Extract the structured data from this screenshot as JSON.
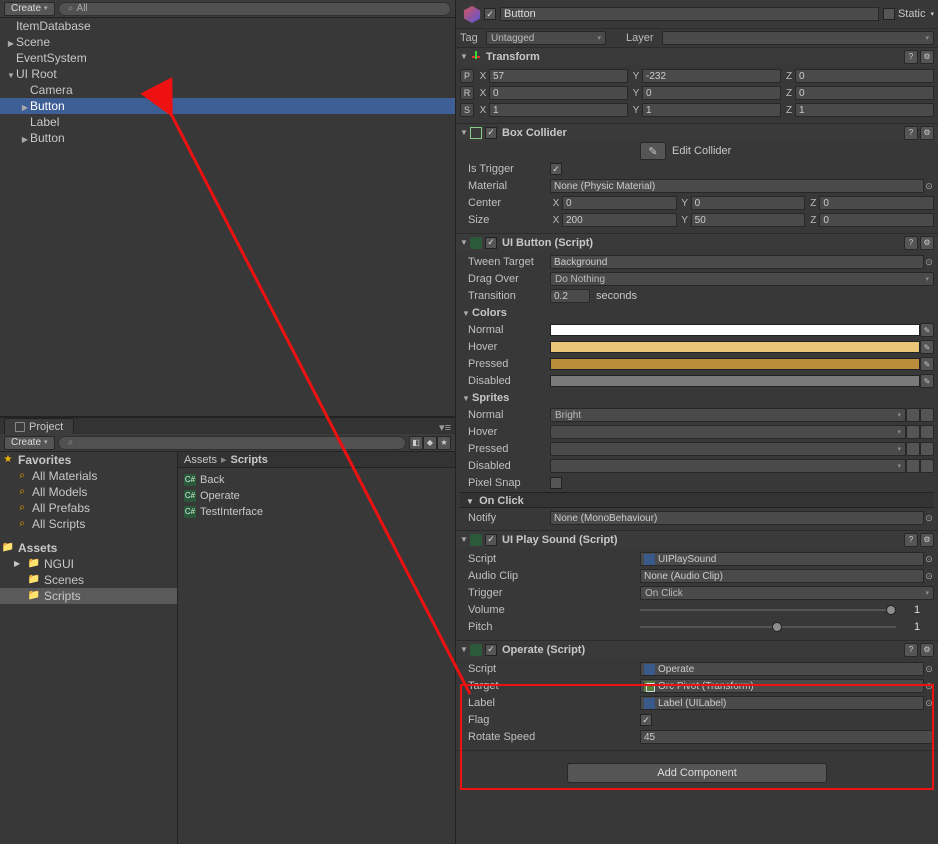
{
  "hierarchy": {
    "create_label": "Create",
    "search_prefix": "All",
    "items": [
      {
        "label": "ItemDatabase",
        "fold": "none",
        "pad": 0
      },
      {
        "label": "Scene",
        "fold": "closed",
        "pad": 0
      },
      {
        "label": "EventSystem",
        "fold": "none",
        "pad": 0
      },
      {
        "label": "UI Root",
        "fold": "open",
        "pad": 0
      },
      {
        "label": "Camera",
        "fold": "none",
        "pad": 1
      },
      {
        "label": "Button",
        "fold": "closed",
        "pad": 1,
        "selected": true
      },
      {
        "label": "Label",
        "fold": "none",
        "pad": 1
      },
      {
        "label": "Button",
        "fold": "closed",
        "pad": 1
      }
    ]
  },
  "project": {
    "tab_label": "Project",
    "create_label": "Create",
    "favorites_label": "Favorites",
    "favorites": [
      "All Materials",
      "All Models",
      "All Prefabs",
      "All Scripts"
    ],
    "assets_label": "Assets",
    "assets_tree": [
      {
        "label": "NGUI",
        "fold": "closed"
      },
      {
        "label": "Scenes",
        "fold": "none"
      },
      {
        "label": "Scripts",
        "fold": "none",
        "selected": true
      }
    ],
    "breadcrumb": [
      "Assets",
      "Scripts"
    ],
    "files": [
      "Back",
      "Operate",
      "TestInterface"
    ]
  },
  "inspector": {
    "go_enabled": true,
    "go_name": "Button",
    "static_label": "Static",
    "tag_label": "Tag",
    "tag_value": "Untagged",
    "layer_label": "Layer",
    "layer_value": "",
    "transform": {
      "title": "Transform",
      "P": {
        "x": "57",
        "y": "-232",
        "z": "0"
      },
      "R": {
        "x": "0",
        "y": "0",
        "z": "0"
      },
      "S": {
        "x": "1",
        "y": "1",
        "z": "1"
      }
    },
    "boxcollider": {
      "title": "Box Collider",
      "edit_label": "Edit Collider",
      "is_trigger_label": "Is Trigger",
      "is_trigger": true,
      "material_label": "Material",
      "material_value": "None (Physic Material)",
      "center_label": "Center",
      "center": {
        "x": "0",
        "y": "0",
        "z": "0"
      },
      "size_label": "Size",
      "size": {
        "x": "200",
        "y": "50",
        "z": "0"
      }
    },
    "uibutton": {
      "title": "UI Button (Script)",
      "tween_target_label": "Tween Target",
      "tween_target_value": "Background",
      "drag_over_label": "Drag Over",
      "drag_over_value": "Do Nothing",
      "transition_label": "Transition",
      "transition_value": "0.2",
      "transition_unit": "seconds",
      "colors_hdr": "Colors",
      "colors": {
        "Normal": "white",
        "Hover": "hover",
        "Pressed": "pressed",
        "Disabled": "disabled"
      },
      "sprites_hdr": "Sprites",
      "sprites": {
        "Normal": "Bright",
        "Hover": "",
        "Pressed": "",
        "Disabled": ""
      },
      "pixel_snap_label": "Pixel Snap",
      "pixel_snap": false,
      "onclick_hdr": "On Click",
      "notify_label": "Notify",
      "notify_value": "None (MonoBehaviour)"
    },
    "playsound": {
      "title": "UI Play Sound (Script)",
      "script_label": "Script",
      "script_value": "UIPlaySound",
      "audioclip_label": "Audio Clip",
      "audioclip_value": "None (Audio Clip)",
      "trigger_label": "Trigger",
      "trigger_value": "On Click",
      "volume_label": "Volume",
      "volume_value": "1",
      "pitch_label": "Pitch",
      "pitch_value": "1"
    },
    "operate": {
      "title": "Operate (Script)",
      "script_label": "Script",
      "script_value": "Operate",
      "target_label": "Target",
      "target_value": "Orc Pivot (Transform)",
      "label_label": "Label",
      "label_value": "Label (UILabel)",
      "flag_label": "Flag",
      "flag": true,
      "rotate_label": "Rotate Speed",
      "rotate_value": "45"
    },
    "add_component_label": "Add Component"
  },
  "axis": {
    "X": "X",
    "Y": "Y",
    "Z": "Z"
  }
}
